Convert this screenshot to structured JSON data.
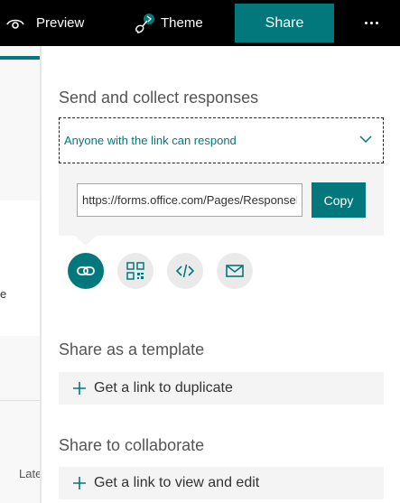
{
  "topbar": {
    "preview_label": "Preview",
    "theme_label": "Theme",
    "share_label": "Share",
    "icons": {
      "preview": "eye-icon",
      "theme": "paint-brush-icon",
      "more": "more-icon"
    }
  },
  "leftpane": {
    "partial_text": "e",
    "partial_text_bottom": "Late"
  },
  "panel": {
    "send_heading": "Send and collect responses",
    "audience_value": "Anyone with the link can respond",
    "link_url": "https://forms.office.com/Pages/ResponsePage.aspx",
    "copy_label": "Copy",
    "share_modes": [
      "link-icon",
      "qr-code-icon",
      "embed-code-icon",
      "email-icon"
    ],
    "template_heading": "Share as a template",
    "duplicate_label": "Get a link to duplicate",
    "collab_heading": "Share to collaborate",
    "view_edit_label": "Get a link to view and edit"
  },
  "colors": {
    "accent": "#03787c",
    "topbar": "#000000",
    "panel_bg": "#f4f4f4"
  }
}
